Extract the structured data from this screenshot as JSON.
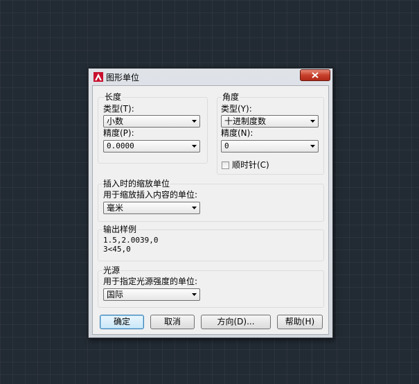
{
  "window": {
    "title": "图形单位",
    "close_label": "×"
  },
  "length": {
    "group_label": "长度",
    "type_label": "类型(T):",
    "type_value": "小数",
    "precision_label": "精度(P):",
    "precision_value": "0.0000"
  },
  "angle": {
    "group_label": "角度",
    "type_label": "类型(Y):",
    "type_value": "十进制度数",
    "precision_label": "精度(N):",
    "precision_value": "0",
    "clockwise_label": "顺时针(C)",
    "clockwise_checked": false
  },
  "insertion": {
    "group_label": "插入时的缩放单位",
    "field_label": "用于缩放插入内容的单位:",
    "value": "毫米"
  },
  "output": {
    "group_label": "输出样例",
    "line1": "1.5,2.0039,0",
    "line2": "3<45,0"
  },
  "lighting": {
    "group_label": "光源",
    "field_label": "用于指定光源强度的单位:",
    "value": "国际"
  },
  "buttons": {
    "ok": "确定",
    "cancel": "取消",
    "direction": "方向(D)...",
    "help": "帮助(H)"
  },
  "colors": {
    "app_icon": "#c8102e",
    "close_button": "#c7402c",
    "background": "#222a33"
  }
}
